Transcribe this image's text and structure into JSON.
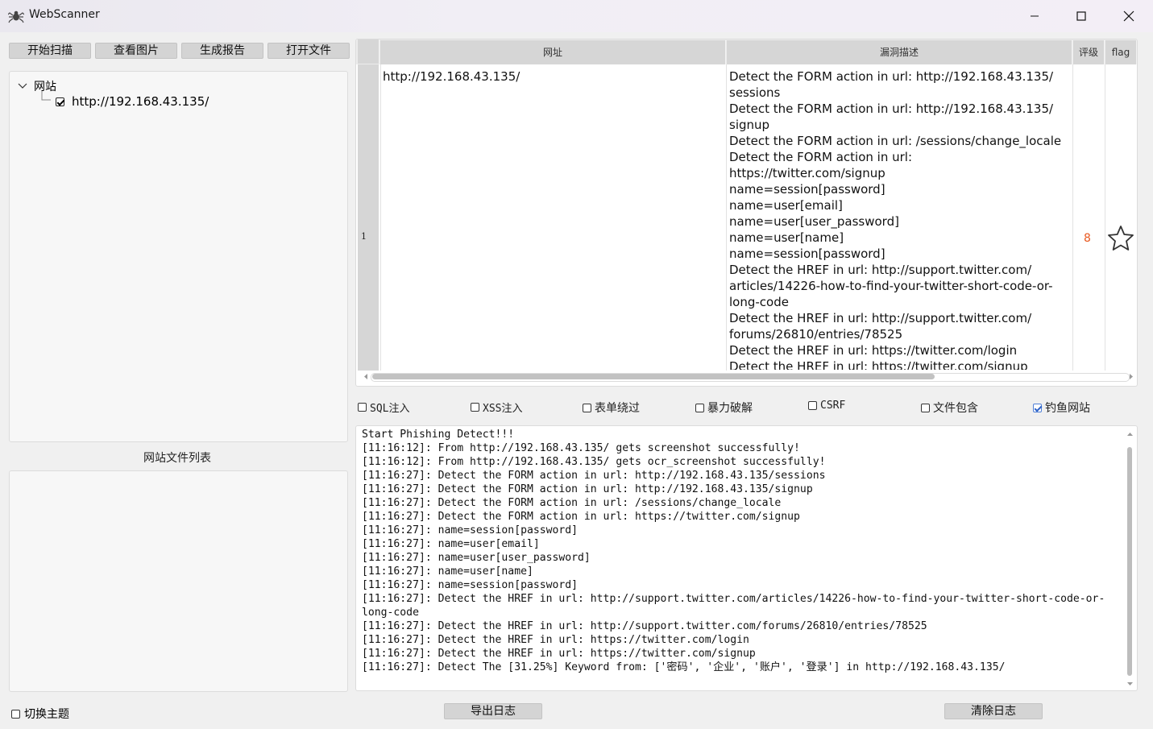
{
  "window": {
    "title": "WebScanner",
    "icon": "spider-icon"
  },
  "toolbar": {
    "start_scan": "开始扫描",
    "view_images": "查看图片",
    "gen_report": "生成报告",
    "open_file": "打开文件"
  },
  "site_tree": {
    "root_label": "网站",
    "expanded": true,
    "children": [
      {
        "label": "http://192.168.43.135/",
        "checked": true
      }
    ]
  },
  "file_list_caption": "网站文件列表",
  "results_table": {
    "columns": [
      "网址",
      "漏洞描述",
      "评级",
      "flag"
    ],
    "rows": [
      {
        "index": "1",
        "url": "http://192.168.43.135/",
        "description_lines": [
          "Detect the FORM action in url: http://192.168.43.135/",
          "sessions",
          "Detect the FORM action in url: http://192.168.43.135/",
          "signup",
          "Detect the FORM action in url: /sessions/change_locale",
          "Detect the FORM action in url: https://twitter.com/signup",
          "name=session[password]",
          "name=user[email]",
          "name=user[user_password]",
          "name=user[name]",
          "name=session[password]",
          "Detect the HREF in url: http://support.twitter.com/",
          "articles/14226-how-to-find-your-twitter-short-code-or-",
          "long-code",
          "Detect the HREF in url: http://support.twitter.com/",
          "forums/26810/entries/78525",
          "Detect the HREF in url: https://twitter.com/login",
          "Detect the HREF in url: https://twitter.com/signup",
          "Detect The [31.25%] Keyword from: ['密码', '企业', '账户',"
        ],
        "rating": "8",
        "flag_icon": "star-outline-icon"
      }
    ]
  },
  "scan_options": [
    {
      "label": "SQL注入",
      "checked": false
    },
    {
      "label": "XSS注入",
      "checked": false
    },
    {
      "label": "表单绕过",
      "checked": false
    },
    {
      "label": "暴力破解",
      "checked": false
    },
    {
      "label": "CSRF",
      "checked": false
    },
    {
      "label": "文件包含",
      "checked": false
    },
    {
      "label": "钓鱼网站",
      "checked": true
    }
  ],
  "log_lines": [
    "Start Phishing Detect!!!",
    "[11:16:12]: From http://192.168.43.135/ gets screenshot successfully!",
    "[11:16:12]: From http://192.168.43.135/ gets ocr_screenshot successfully!",
    "[11:16:27]: Detect the FORM action in url: http://192.168.43.135/sessions",
    "[11:16:27]: Detect the FORM action in url: http://192.168.43.135/signup",
    "[11:16:27]: Detect the FORM action in url: /sessions/change_locale",
    "[11:16:27]: Detect the FORM action in url: https://twitter.com/signup",
    "[11:16:27]: name=session[password]",
    "[11:16:27]: name=user[email]",
    "[11:16:27]: name=user[user_password]",
    "[11:16:27]: name=user[name]",
    "[11:16:27]: name=session[password]",
    "[11:16:27]: Detect the HREF in url: http://support.twitter.com/articles/14226-how-to-find-your-twitter-short-code-or-",
    "long-code",
    "[11:16:27]: Detect the HREF in url: http://support.twitter.com/forums/26810/entries/78525",
    "[11:16:27]: Detect the HREF in url: https://twitter.com/login",
    "[11:16:27]: Detect the HREF in url: https://twitter.com/signup",
    "[11:16:27]: Detect The [31.25%] Keyword from: ['密码', '企业', '账户', '登录'] in http://192.168.43.135/"
  ],
  "footer": {
    "theme_toggle": {
      "label": "切换主题",
      "checked": false
    },
    "export_log": "导出日志",
    "clear_log": "清除日志"
  },
  "colors": {
    "rating": "#e8571e",
    "checkbox_checked": "#2d62c8"
  }
}
